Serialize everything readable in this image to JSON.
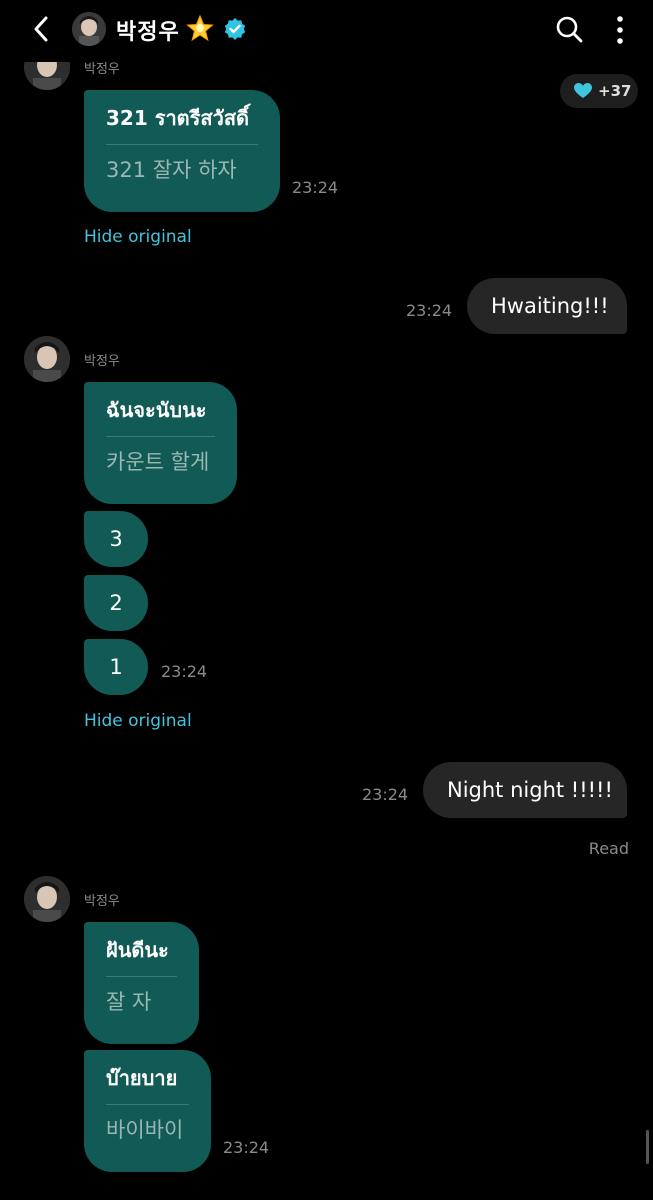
{
  "header": {
    "title": "박정우",
    "icons": [
      "back-icon",
      "avatar",
      "star-icon",
      "verified-badge-icon",
      "search-icon",
      "more-vertical-icon"
    ]
  },
  "likes": {
    "count": "+37",
    "icon": "heart-icon",
    "color": "#3fc6dc"
  },
  "colors": {
    "incoming_bubble": "#115a55",
    "outgoing_bubble": "#262626",
    "link": "#3fc6dc",
    "background": "#000000"
  },
  "messages": {
    "m1": {
      "original": "321 ราตรีสวัสดิ์",
      "translation": "321 잘자 하자",
      "time": "23:24",
      "hide_label": "Hide original"
    },
    "m2": {
      "text": "Hwaiting!!!",
      "time": "23:24"
    },
    "g2": {
      "sender": "박정우",
      "original": "ฉันจะนับนะ",
      "translation": "카운트 할게",
      "n3": "3",
      "n2": "2",
      "n1": "1",
      "time": "23:24",
      "hide_label": "Hide original"
    },
    "m3": {
      "text": "Night night !!!!!",
      "time": "23:24",
      "status": "Read"
    },
    "g3": {
      "sender": "박정우",
      "a_original": "ฝันดีนะ",
      "a_translation": "잘 자",
      "b_original": "บ๊ายบาย",
      "b_translation": "바이바이",
      "time": "23:24"
    },
    "g1_sender_partial": "박정우"
  }
}
